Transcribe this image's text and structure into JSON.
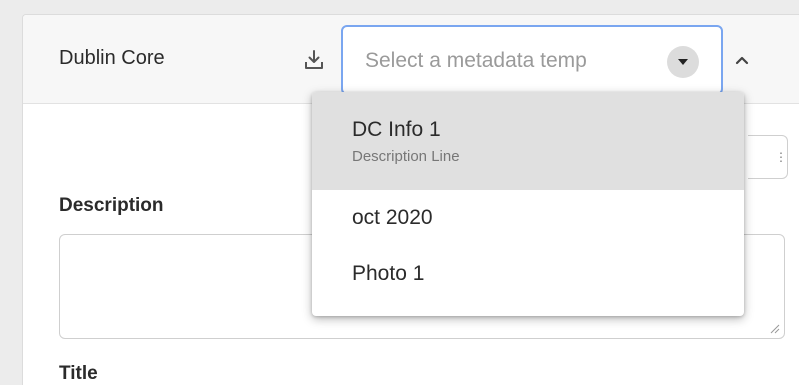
{
  "panel": {
    "title": "Dublin Core",
    "download_icon": "download-icon",
    "collapse_icon": "chevron-up-icon"
  },
  "template_select": {
    "placeholder": "Select a metadata temp",
    "caret_icon": "caret-down-icon",
    "border_color": "#7aa6f0",
    "options": [
      {
        "label": "DC Info 1",
        "sublabel": "Description Line"
      },
      {
        "label": "oct 2020"
      },
      {
        "label": "Photo 1"
      }
    ]
  },
  "fields": {
    "description_label": "Description",
    "title_label": "Title"
  }
}
